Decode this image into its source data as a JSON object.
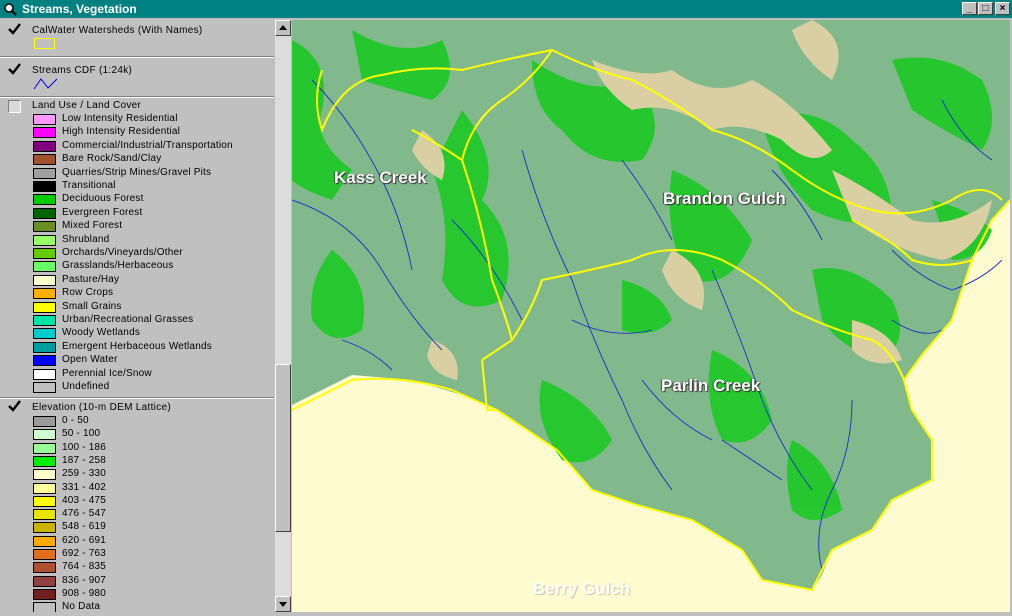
{
  "window": {
    "title": "Streams, Vegetation",
    "minimize_glyph": "_",
    "maximize_glyph": "□",
    "close_glyph": "×"
  },
  "toc": {
    "layers": [
      {
        "name": "CalWater Watersheds (With Names)",
        "checked": true,
        "symbol_color": "#ffff00"
      },
      {
        "name": "Streams CDF (1:24k)",
        "checked": true,
        "symbol_color": "#0000ff"
      },
      {
        "name": "Land Use / Land Cover",
        "checked": false
      },
      {
        "name": "Elevation (10-m DEM Lattice)",
        "checked": true
      }
    ],
    "landcover_classes": [
      {
        "label": "Low Intensity Residential",
        "color": "#ff99ff"
      },
      {
        "label": "High Intensity Residential",
        "color": "#ff00ff"
      },
      {
        "label": "Commercial/Industrial/Transportation",
        "color": "#800080"
      },
      {
        "label": "Bare Rock/Sand/Clay",
        "color": "#a0522d"
      },
      {
        "label": "Quarries/Strip Mines/Gravel Pits",
        "color": "#a0a0a0"
      },
      {
        "label": "Transitional",
        "color": "#000000"
      },
      {
        "label": "Deciduous Forest",
        "color": "#00cc00"
      },
      {
        "label": "Evergreen Forest",
        "color": "#006400"
      },
      {
        "label": "Mixed Forest",
        "color": "#6b8e23"
      },
      {
        "label": "Shrubland",
        "color": "#99ff66"
      },
      {
        "label": "Orchards/Vineyards/Other",
        "color": "#66cc00"
      },
      {
        "label": "Grasslands/Herbaceous",
        "color": "#66ff66"
      },
      {
        "label": "Pasture/Hay",
        "color": "#ffffcc"
      },
      {
        "label": "Row Crops",
        "color": "#ffb000"
      },
      {
        "label": "Small Grains",
        "color": "#ffff00"
      },
      {
        "label": "Urban/Recreational Grasses",
        "color": "#00e6a8"
      },
      {
        "label": "Woody Wetlands",
        "color": "#00cccc"
      },
      {
        "label": "Emergent Herbaceous Wetlands",
        "color": "#00a0a0"
      },
      {
        "label": "Open Water",
        "color": "#0000ff"
      },
      {
        "label": "Perennial Ice/Snow",
        "color": "#ffffff"
      },
      {
        "label": "Undefined",
        "color": "#c0c0c0"
      }
    ],
    "elevation_classes": [
      {
        "label": "0 - 50",
        "color": "#9a9a9a"
      },
      {
        "label": "50 - 100",
        "color": "#ccffcc"
      },
      {
        "label": "100 - 186",
        "color": "#99ff99"
      },
      {
        "label": "187 - 258",
        "color": "#00ee00"
      },
      {
        "label": "259 - 330",
        "color": "#ffffcc"
      },
      {
        "label": "331 - 402",
        "color": "#ffff99"
      },
      {
        "label": "403 - 475",
        "color": "#ffff00"
      },
      {
        "label": "476 - 547",
        "color": "#e6e600"
      },
      {
        "label": "548 - 619",
        "color": "#ccb300"
      },
      {
        "label": "620 - 691",
        "color": "#ffaa00"
      },
      {
        "label": "692 - 763",
        "color": "#e07020"
      },
      {
        "label": "764 - 835",
        "color": "#b05030"
      },
      {
        "label": "836 - 907",
        "color": "#904040"
      },
      {
        "label": "908 - 980",
        "color": "#702020"
      },
      {
        "label": "No Data",
        "color": "#c0c0c0"
      }
    ]
  },
  "map": {
    "labels": {
      "kass_creek": "Kass Creek",
      "brandon_gulch": "Brandon Gulch",
      "parlin_creek": "Parlin Creek",
      "berry_gulch": "Berry Gulch"
    },
    "colors": {
      "terrain": "#7fb88a",
      "forest": "#1fcc1f",
      "ridge": "#d8cfa0",
      "nodata": "#fffbd0",
      "watershed": "#ffff00",
      "stream": "#1a2ccc"
    }
  }
}
